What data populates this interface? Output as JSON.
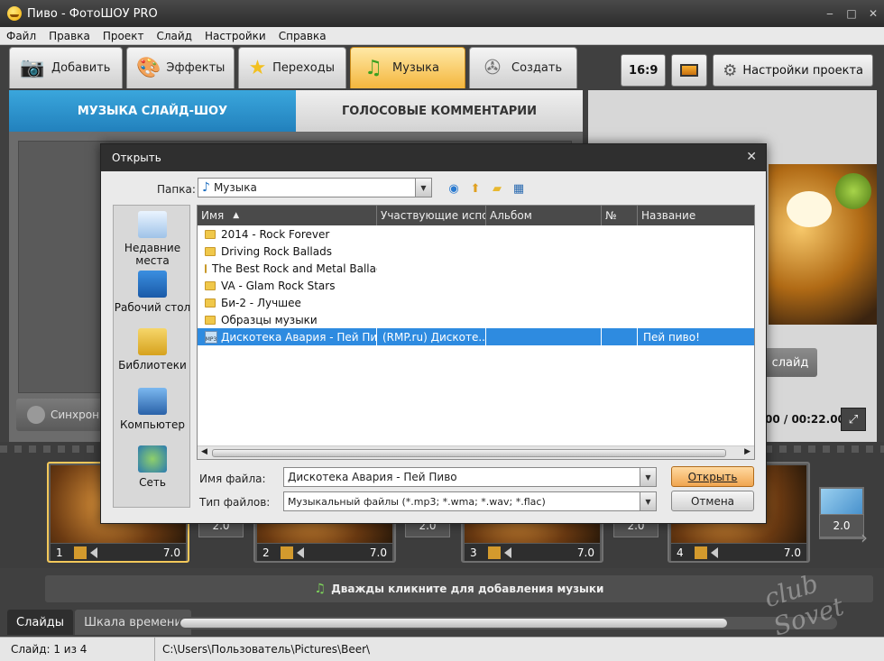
{
  "window": {
    "title": "Пиво - ФотоШОУ PRO",
    "minimize": "‒",
    "maximize": "□",
    "close": "✕"
  },
  "menu": [
    "Файл",
    "Правка",
    "Проект",
    "Слайд",
    "Настройки",
    "Справка"
  ],
  "main_tabs": [
    {
      "label": "Добавить",
      "icon": "camera-icon"
    },
    {
      "label": "Эффекты",
      "icon": "palette-icon"
    },
    {
      "label": "Переходы",
      "icon": "star-icon"
    },
    {
      "label": "Музыка",
      "icon": "music-note-icon",
      "active": true
    },
    {
      "label": "Создать",
      "icon": "film-reel-icon"
    }
  ],
  "right_buttons": {
    "aspect": "16:9",
    "settings": "Настройки проекта"
  },
  "sub_tabs": [
    "МУЗЫКА СЛАЙД-ШОУ",
    "ГОЛОСОВЫЕ КОММЕНТАРИИ"
  ],
  "sync_label": "Синхрони",
  "preview": {
    "slide_button": "слайд",
    "time": "00 / 00:22.000"
  },
  "dialog": {
    "title": "Открыть",
    "close": "✕",
    "folder_label": "Папка:",
    "folder_value": "Музыка",
    "places": [
      "Недавние места",
      "Рабочий стол",
      "Библиотеки",
      "Компьютер",
      "Сеть"
    ],
    "columns": [
      "Имя",
      "Участвующие испол...",
      "Альбом",
      "№",
      "Название"
    ],
    "folders": [
      "2014 - Rock Forever",
      "Driving Rock Ballads",
      "The Best Rock and Metal Ballads",
      "VA - Glam Rock Stars",
      "Би-2 - Лучшее",
      "Образцы музыки"
    ],
    "selected_file": {
      "name": "Дискотека Авария - Пей Пиво",
      "artist": "(RMP.ru) Дискоте...",
      "album": "",
      "number": "",
      "title": "Пей пиво!"
    },
    "filename_label": "Имя файла:",
    "filename_value": "Дискотека Авария - Пей Пиво",
    "filetype_label": "Тип файлов:",
    "filetype_value": "Музыкальный файлы (*.mp3; *.wma; *.wav; *.flac)",
    "open_button": "Открыть",
    "cancel_button": "Отмена"
  },
  "slides": [
    {
      "num": "1",
      "dur": "7.0",
      "selected": true
    },
    {
      "num": "2",
      "dur": "7.0"
    },
    {
      "num": "3",
      "dur": "7.0"
    },
    {
      "num": "4",
      "dur": "7.0"
    }
  ],
  "transitions": [
    "2.0",
    "2.0",
    "2.0",
    "2.0"
  ],
  "music_strip": "Дважды кликните для добавления музыки",
  "bottom_tabs": [
    "Слайды",
    "Шкала времени"
  ],
  "status": {
    "slide": "Слайд: 1 из 4",
    "path": "C:\\Users\\Пользователь\\Pictures\\Beer\\"
  },
  "watermark": "club Sovet"
}
